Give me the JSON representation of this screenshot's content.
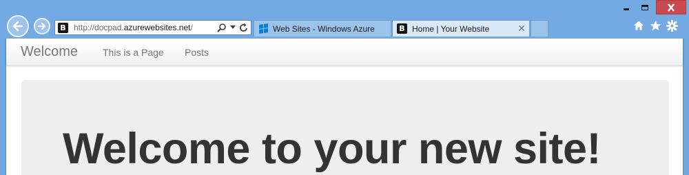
{
  "browser": {
    "address_bar": {
      "favicon_letter": "B",
      "url_prefix": "http://docpad.",
      "url_domain": "azurewebsites.net",
      "url_suffix": "/"
    },
    "tabs": [
      {
        "label": "Web Sites - Windows Azure",
        "icon": "windows-logo-icon",
        "active": false
      },
      {
        "label": "Home | Your Website",
        "icon": "bootstrap-favicon-icon",
        "favicon_letter": "B",
        "active": true,
        "close_glyph": "✕"
      }
    ],
    "toolbar_icons": [
      "home-icon",
      "favorites-star-icon",
      "settings-gear-icon"
    ],
    "colors": {
      "chrome_background": "#73aae4",
      "close_button": "#c74b50",
      "active_tab": "#d9e9f8",
      "windows_logo": "#0a7fd9"
    }
  },
  "site": {
    "navbar": {
      "brand": "Welcome",
      "links": [
        "This is a Page",
        "Posts"
      ]
    },
    "hero": {
      "title": "Welcome to your new site!"
    },
    "colors": {
      "jumbotron_background": "#eeeeee",
      "title_text": "#333333",
      "nav_text": "#777777"
    }
  }
}
